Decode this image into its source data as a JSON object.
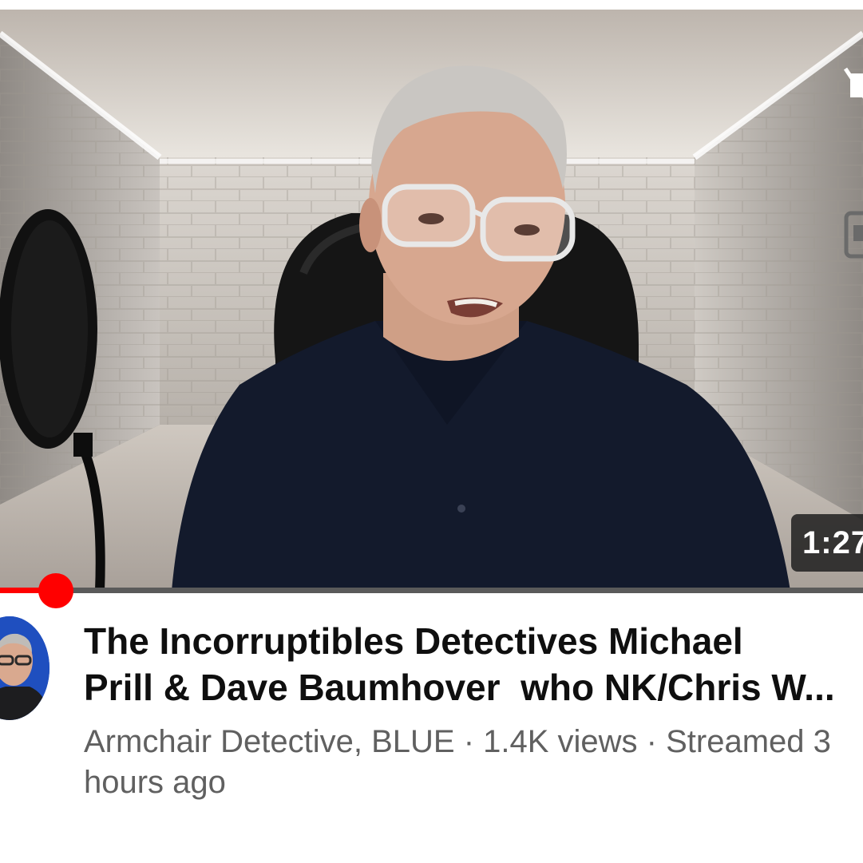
{
  "video": {
    "duration": "1:27",
    "progress_fraction": 0.065,
    "mute_icon": "volume-off-icon",
    "miniplayer_icon": "captions-icon"
  },
  "channel": {
    "avatar_icon": "channel-avatar"
  },
  "title_lines": [
    "The Incorruptibles Detectives Michael",
    "Prill & Dave Baumhover  who NK/Chris W..."
  ],
  "meta": {
    "line1": "Armchair Detective, BLUE  · 1.4K views · Streamed 3",
    "line2": "hours ago"
  },
  "colors": {
    "accent": "#ff0000",
    "title": "#0f0f0f",
    "meta": "#606060",
    "badge_bg": "#1e1e1e"
  }
}
